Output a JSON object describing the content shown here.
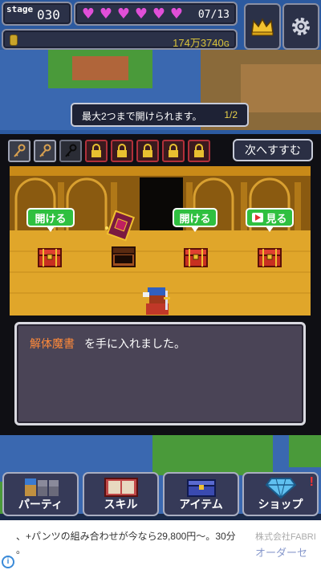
{
  "hud": {
    "stage_label": "stage",
    "stage_number": "030",
    "hearts_filled": 6,
    "hearts_text": "07/13",
    "gold_amount": "174万3740ɢ"
  },
  "notice": {
    "text": "最大2つまで開けられます。",
    "count": "1/2"
  },
  "keys": [
    {
      "state": "key",
      "icon": "key-icon"
    },
    {
      "state": "key",
      "icon": "key-icon"
    },
    {
      "state": "key-dark",
      "icon": "key-icon"
    },
    {
      "state": "locked",
      "icon": "padlock-icon"
    },
    {
      "state": "locked",
      "icon": "padlock-icon"
    },
    {
      "state": "locked",
      "icon": "padlock-icon"
    },
    {
      "state": "locked",
      "icon": "padlock-icon"
    },
    {
      "state": "locked",
      "icon": "padlock-icon"
    }
  ],
  "next_button": "次へすすむ",
  "chests": [
    {
      "button": "開ける",
      "state": "closed"
    },
    {
      "button": "",
      "state": "opened"
    },
    {
      "button": "開ける",
      "state": "closed"
    },
    {
      "button": "見る",
      "state": "closed",
      "video": true
    }
  ],
  "message": {
    "item_name": "解体魔書",
    "rest": "を手に入れました。"
  },
  "nav": [
    {
      "label": "パーティ",
      "icon": "party-icon"
    },
    {
      "label": "スキル",
      "icon": "skill-book-icon"
    },
    {
      "label": "アイテム",
      "icon": "item-chest-icon"
    },
    {
      "label": "ショップ",
      "icon": "diamond-icon",
      "badge": "!"
    }
  ],
  "ad": {
    "text_line1": "、+パンツの組み合わせが今なら29,800円〜。30分",
    "text_line2": "。",
    "company": "株式会社FABRI",
    "cta": "オーダーセ",
    "info_icon": "i"
  },
  "colors": {
    "gold_text": "#d8c23a",
    "heart": "#e04fd8",
    "item_highlight": "#ff8a3a",
    "open_button": "#2fc040"
  }
}
